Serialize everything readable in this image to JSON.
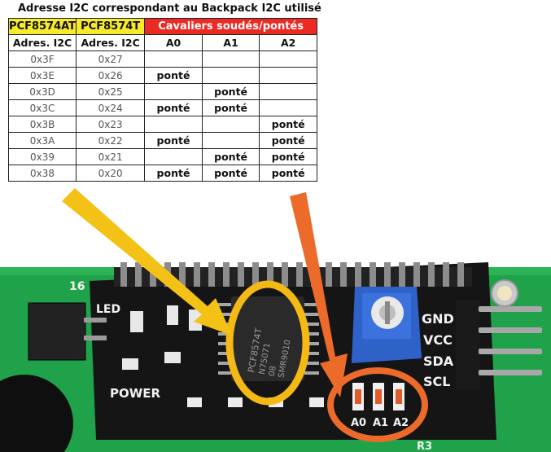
{
  "title": "Adresse I2C correspondant au Backpack I2C utilisé",
  "table": {
    "headers": {
      "col1": "PCF8574AT",
      "col2": "PCF8574T",
      "group": "Cavaliers soudés/pontés",
      "sub1": "Adres. I2C",
      "sub2": "Adres. I2C",
      "a0": "A0",
      "a1": "A1",
      "a2": "A2"
    },
    "rows": [
      {
        "at": "0x3F",
        "t": "0x27",
        "a0": "",
        "a1": "",
        "a2": ""
      },
      {
        "at": "0x3E",
        "t": "0x26",
        "a0": "ponté",
        "a1": "",
        "a2": ""
      },
      {
        "at": "0x3D",
        "t": "0x25",
        "a0": "",
        "a1": "ponté",
        "a2": ""
      },
      {
        "at": "0x3C",
        "t": "0x24",
        "a0": "ponté",
        "a1": "ponté",
        "a2": ""
      },
      {
        "at": "0x3B",
        "t": "0x23",
        "a0": "",
        "a1": "",
        "a2": "ponté"
      },
      {
        "at": "0x3A",
        "t": "0x22",
        "a0": "ponté",
        "a1": "",
        "a2": "ponté"
      },
      {
        "at": "0x39",
        "t": "0x21",
        "a0": "",
        "a1": "ponté",
        "a2": "ponté"
      },
      {
        "at": "0x38",
        "t": "0x20",
        "a0": "ponté",
        "a1": "ponté",
        "a2": "ponté"
      }
    ]
  },
  "board": {
    "chip_text": [
      "PCF8574T",
      "N75071",
      "08",
      "SMR9010"
    ],
    "pin_labels": [
      "GND",
      "VCC",
      "SDA",
      "SCL"
    ],
    "led_label": "LED",
    "power_label": "POWER",
    "jumper_labels": [
      "A0",
      "A1",
      "A2"
    ],
    "pcb_number": "16",
    "corner_label": "R3",
    "colors": {
      "pcb_green": "#1fa24a",
      "board_black": "#151515",
      "arrow_yellow": "#f4c117",
      "arrow_orange": "#ec6a2a",
      "pot_blue": "#2f62c9"
    }
  }
}
